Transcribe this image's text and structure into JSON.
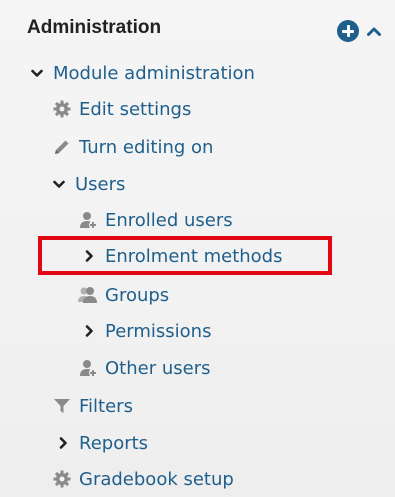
{
  "block": {
    "title": "Administration",
    "colors": {
      "link": "#1f5f8b",
      "highlight": "#e30613",
      "icon_grey": "#8a8a8a"
    }
  },
  "header_icons": {
    "add": "plus-circle-icon",
    "collapse": "chevron-up-icon"
  },
  "tree": {
    "module_administration": "Module administration",
    "edit_settings": "Edit settings",
    "turn_editing_on": "Turn editing on",
    "users": "Users",
    "enrolled_users": "Enrolled users",
    "enrolment_methods": "Enrolment methods",
    "groups": "Groups",
    "permissions": "Permissions",
    "other_users": "Other users",
    "filters": "Filters",
    "reports": "Reports",
    "gradebook_setup": "Gradebook setup"
  }
}
